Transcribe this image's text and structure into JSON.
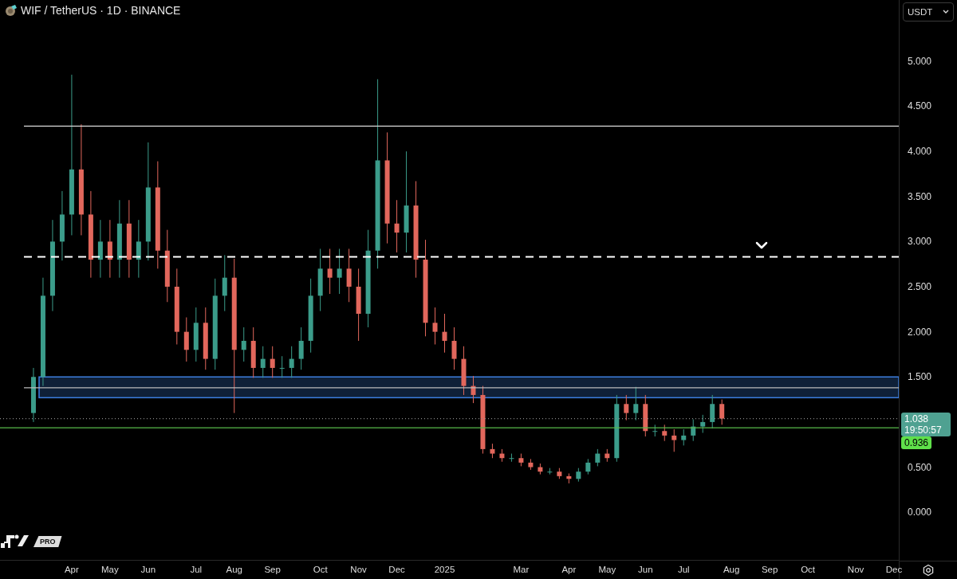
{
  "header": {
    "symbol_title": "WIF / TetherUS · 1D · BINANCE"
  },
  "currency_selector": {
    "value": "USDT"
  },
  "chart": {
    "chart_data": {
      "type": "candlestick",
      "categories": [
        null,
        null,
        null,
        null,
        null,
        null,
        null,
        "Apr",
        null,
        null,
        null,
        "May",
        null,
        null,
        null,
        "Jun",
        null,
        null,
        null,
        null,
        "Jul",
        null,
        null,
        null,
        "Aug",
        null,
        null,
        null,
        "Sep",
        null,
        null,
        null,
        null,
        "Oct",
        null,
        null,
        null,
        "Nov",
        null,
        null,
        null,
        "Dec",
        null,
        null,
        null,
        null,
        "2025",
        null,
        null,
        null,
        null,
        null,
        null,
        null,
        "Mar",
        null,
        null,
        null,
        null,
        "Apr",
        null,
        null,
        null,
        "May",
        null,
        null,
        null,
        "Jun",
        null,
        null,
        null,
        "Jul",
        null,
        null,
        null,
        null,
        "Aug",
        null,
        null,
        null,
        "Sep",
        null,
        null,
        null,
        "Oct",
        null,
        null,
        null,
        null,
        "Nov",
        null,
        null,
        null,
        "Dec"
      ],
      "ohlc": [
        null,
        null,
        null,
        [
          1.1,
          1.6,
          1.0,
          1.5
        ],
        [
          1.5,
          2.6,
          1.4,
          2.4
        ],
        [
          2.4,
          3.24,
          2.23,
          3.0
        ],
        [
          3.0,
          3.56,
          2.79,
          3.3
        ],
        [
          3.3,
          4.85,
          3.07,
          3.8
        ],
        [
          3.8,
          4.3,
          3.07,
          3.3
        ],
        [
          3.3,
          3.56,
          2.6,
          2.8
        ],
        [
          2.8,
          3.24,
          2.6,
          3.0
        ],
        [
          3.0,
          3.24,
          2.6,
          2.8
        ],
        [
          2.8,
          3.46,
          2.6,
          3.2
        ],
        [
          3.2,
          3.46,
          2.6,
          2.8
        ],
        [
          2.8,
          3.24,
          2.6,
          3.0
        ],
        [
          3.0,
          4.1,
          2.79,
          3.6
        ],
        [
          3.6,
          3.89,
          2.7,
          2.9
        ],
        [
          2.9,
          3.13,
          2.33,
          2.5
        ],
        [
          2.5,
          2.7,
          1.86,
          2.0
        ],
        [
          2.0,
          2.16,
          1.67,
          1.8
        ],
        [
          1.8,
          2.27,
          1.67,
          2.1
        ],
        [
          2.1,
          2.27,
          1.58,
          1.7
        ],
        [
          1.7,
          2.59,
          1.58,
          2.4
        ],
        [
          2.4,
          2.85,
          2.23,
          2.6
        ],
        [
          2.6,
          2.81,
          1.1,
          1.8
        ],
        [
          1.8,
          2.05,
          1.67,
          1.9
        ],
        [
          1.9,
          2.05,
          1.49,
          1.6
        ],
        [
          1.6,
          1.84,
          1.49,
          1.7
        ],
        [
          1.7,
          1.84,
          1.49,
          1.6
        ],
        [
          1.6,
          1.73,
          1.49,
          1.6
        ],
        [
          1.6,
          1.84,
          1.49,
          1.7
        ],
        [
          1.7,
          2.05,
          1.58,
          1.9
        ],
        [
          1.9,
          2.59,
          1.77,
          2.4
        ],
        [
          2.4,
          2.92,
          2.23,
          2.7
        ],
        [
          2.7,
          2.92,
          2.42,
          2.6
        ],
        [
          2.6,
          2.92,
          2.42,
          2.7
        ],
        [
          2.7,
          2.92,
          2.33,
          2.5
        ],
        [
          2.5,
          2.7,
          1.9,
          2.2
        ],
        [
          2.2,
          3.13,
          2.05,
          2.9
        ],
        [
          2.9,
          4.8,
          2.7,
          3.9
        ],
        [
          3.9,
          4.21,
          2.98,
          3.2
        ],
        [
          3.2,
          3.46,
          2.88,
          3.1
        ],
        [
          3.1,
          4.0,
          2.88,
          3.4
        ],
        [
          3.4,
          3.67,
          2.6,
          2.8
        ],
        [
          2.8,
          3.02,
          1.95,
          2.1
        ],
        [
          2.1,
          2.27,
          1.86,
          2.0
        ],
        [
          2.0,
          2.2,
          1.77,
          1.9
        ],
        [
          1.9,
          2.05,
          1.58,
          1.7
        ],
        [
          1.7,
          1.84,
          1.3,
          1.4
        ],
        [
          1.4,
          1.51,
          1.21,
          1.3
        ],
        [
          1.3,
          1.4,
          0.65,
          0.7
        ],
        [
          0.7,
          0.76,
          0.6,
          0.65
        ],
        [
          0.65,
          0.7,
          0.56,
          0.6
        ],
        [
          0.6,
          0.65,
          0.56,
          0.6
        ],
        [
          0.6,
          0.65,
          0.51,
          0.55
        ],
        [
          0.55,
          0.59,
          0.47,
          0.5
        ],
        [
          0.5,
          0.54,
          0.42,
          0.45
        ],
        [
          0.45,
          0.49,
          0.42,
          0.45
        ],
        [
          0.45,
          0.49,
          0.37,
          0.4
        ],
        [
          0.4,
          0.43,
          0.32,
          0.37
        ],
        [
          0.37,
          0.49,
          0.34,
          0.45
        ],
        [
          0.45,
          0.59,
          0.42,
          0.55
        ],
        [
          0.55,
          0.7,
          0.51,
          0.65
        ],
        [
          0.65,
          0.7,
          0.56,
          0.6
        ],
        [
          0.6,
          1.3,
          0.56,
          1.2
        ],
        [
          1.2,
          1.3,
          1.02,
          1.1
        ],
        [
          1.1,
          1.39,
          1.02,
          1.2
        ],
        [
          1.2,
          1.3,
          0.84,
          0.9
        ],
        [
          0.9,
          0.97,
          0.84,
          0.9
        ],
        [
          0.9,
          0.97,
          0.79,
          0.85
        ],
        [
          0.85,
          0.92,
          0.67,
          0.8
        ],
        [
          0.8,
          0.92,
          0.74,
          0.85
        ],
        [
          0.85,
          1.03,
          0.79,
          0.95
        ],
        [
          0.95,
          1.08,
          0.88,
          1.0
        ],
        [
          1.0,
          1.3,
          0.93,
          1.2
        ],
        [
          1.2,
          1.25,
          0.97,
          1.038
        ],
        null,
        null,
        null,
        null,
        null,
        null,
        null,
        null,
        null,
        null,
        null,
        null,
        null,
        null,
        null,
        null,
        null,
        null
      ],
      "ylim": [
        -0.528,
        5.678
      ],
      "yticks": [
        {
          "value": 5,
          "label": "5.000"
        },
        {
          "value": 4.5,
          "label": "4.500"
        },
        {
          "value": 4,
          "label": "4.000"
        },
        {
          "value": 3.5,
          "label": "3.500"
        },
        {
          "value": 3,
          "label": "3.000"
        },
        {
          "value": 2.5,
          "label": "2.500"
        },
        {
          "value": 2,
          "label": "2.000"
        },
        {
          "value": 1.5,
          "label": "1.500"
        },
        {
          "value": 0.5,
          "label": "0.500"
        },
        {
          "value": 0,
          "label": "0.000"
        }
      ],
      "ref_lines": [
        {
          "axis": "y",
          "value": 4.28,
          "color": "#d8d8d8"
        },
        {
          "axis": "y",
          "value": 2.83,
          "color": "#ffffff"
        },
        {
          "axis": "y",
          "value": 1.38,
          "color": "#bbbbbb"
        },
        {
          "axis": "y",
          "value": 0.936,
          "color": "#57b84a"
        },
        {
          "axis": "y",
          "value": 1.038,
          "color": "#888888"
        }
      ],
      "bands": [
        {
          "axis": "y",
          "from": 1.27,
          "to": 1.5,
          "color": "#3d7fe0"
        }
      ]
    }
  },
  "price_scale": {
    "last_price": "1.038",
    "countdown": "19:50:57",
    "alert_price": "0.936"
  },
  "footer": {
    "badge": "PRO"
  }
}
